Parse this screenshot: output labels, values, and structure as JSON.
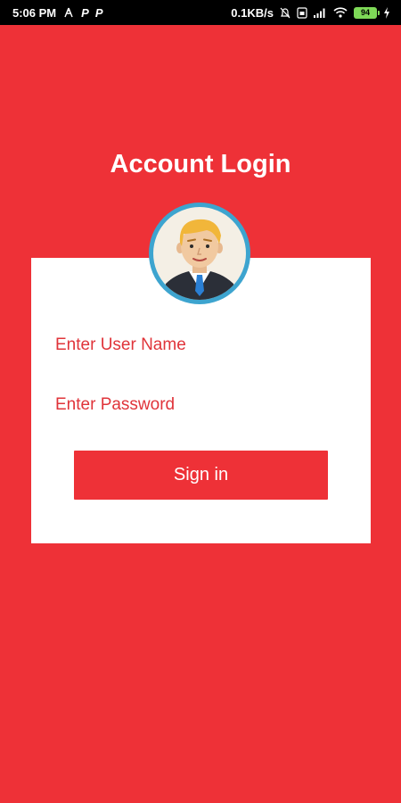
{
  "status_bar": {
    "time": "5:06 PM",
    "left_icons": [
      "signal-tower-icon",
      "p-icon",
      "p-icon"
    ],
    "net_speed": "0.1KB/s",
    "right_icons": [
      "mute-bell-icon",
      "dual-sim-icon",
      "cell-signal-icon",
      "wifi-icon",
      "battery-icon",
      "charging-icon"
    ],
    "battery_level": "94"
  },
  "page": {
    "title": "Account Login"
  },
  "form": {
    "username_placeholder": "Enter User Name",
    "password_placeholder": "Enter Password",
    "submit_label": "Sign in"
  },
  "colors": {
    "background": "#ee3137",
    "card": "#ffffff",
    "field_text": "#e0343a",
    "button": "#ee3137",
    "avatar_ring": "#3da4cf"
  }
}
